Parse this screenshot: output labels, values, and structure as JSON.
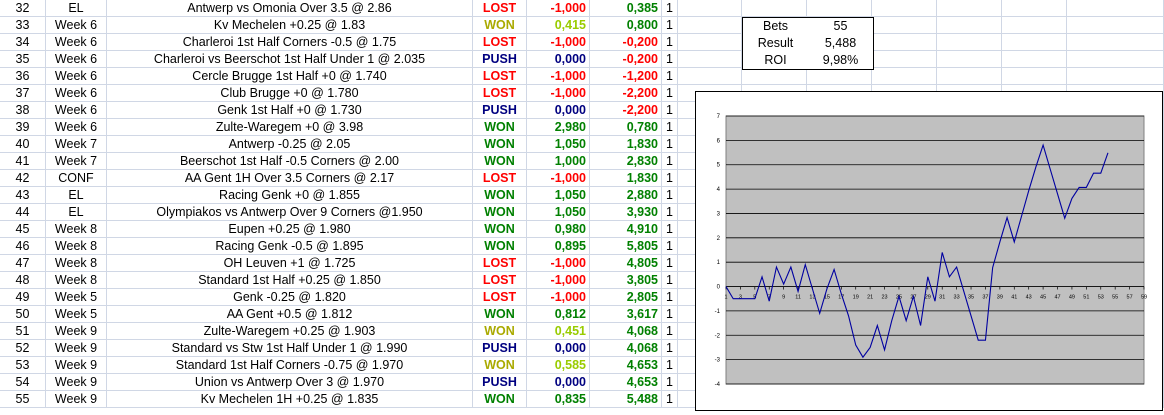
{
  "rows": [
    {
      "n": "32",
      "comp": "EL",
      "bet": "Antwerp vs Omonia Over 3.5 @ 2.86",
      "res": "LOST",
      "profit": "-1,000",
      "total": "0,385",
      "stake": "1"
    },
    {
      "n": "33",
      "comp": "Week 6",
      "bet": "Kv Mechelen +0.25 @ 1.83",
      "res": "WON",
      "profit": "0,415",
      "total": "0,800",
      "stake": "1"
    },
    {
      "n": "34",
      "comp": "Week 6",
      "bet": "Charleroi 1st Half Corners -0.5 @ 1.75",
      "res": "LOST",
      "profit": "-1,000",
      "total": "-0,200",
      "stake": "1"
    },
    {
      "n": "35",
      "comp": "Week 6",
      "bet": "Charleroi vs Beerschot 1st Half Under 1 @ 2.035",
      "res": "PUSH",
      "profit": "0,000",
      "total": "-0,200",
      "stake": "1"
    },
    {
      "n": "36",
      "comp": "Week 6",
      "bet": "Cercle Brugge 1st Half +0 @ 1.740",
      "res": "LOST",
      "profit": "-1,000",
      "total": "-1,200",
      "stake": "1"
    },
    {
      "n": "37",
      "comp": "Week 6",
      "bet": "Club Brugge +0 @ 1.780",
      "res": "LOST",
      "profit": "-1,000",
      "total": "-2,200",
      "stake": "1"
    },
    {
      "n": "38",
      "comp": "Week 6",
      "bet": "Genk 1st Half +0 @ 1.730",
      "res": "PUSH",
      "profit": "0,000",
      "total": "-2,200",
      "stake": "1"
    },
    {
      "n": "39",
      "comp": "Week 6",
      "bet": "Zulte-Waregem +0 @ 3.98",
      "res": "WON",
      "profit": "2,980",
      "total": "0,780",
      "stake": "1"
    },
    {
      "n": "40",
      "comp": "Week 7",
      "bet": "Antwerp -0.25 @ 2.05",
      "res": "WON",
      "profit": "1,050",
      "total": "1,830",
      "stake": "1"
    },
    {
      "n": "41",
      "comp": "Week 7",
      "bet": "Beerschot 1st Half -0.5 Corners @ 2.00",
      "res": "WON",
      "profit": "1,000",
      "total": "2,830",
      "stake": "1"
    },
    {
      "n": "42",
      "comp": "CONF",
      "bet": "AA Gent 1H Over 3.5 Corners @ 2.17",
      "res": "LOST",
      "profit": "-1,000",
      "total": "1,830",
      "stake": "1"
    },
    {
      "n": "43",
      "comp": "EL",
      "bet": "Racing Genk +0 @ 1.855",
      "res": "WON",
      "profit": "1,050",
      "total": "2,880",
      "stake": "1"
    },
    {
      "n": "44",
      "comp": "EL",
      "bet": "Olympiakos vs Antwerp Over 9 Corners @1.950",
      "res": "WON",
      "profit": "1,050",
      "total": "3,930",
      "stake": "1"
    },
    {
      "n": "45",
      "comp": "Week 8",
      "bet": "Eupen +0.25 @ 1.980",
      "res": "WON",
      "profit": "0,980",
      "total": "4,910",
      "stake": "1"
    },
    {
      "n": "46",
      "comp": "Week 8",
      "bet": "Racing Genk -0.5 @ 1.895",
      "res": "WON",
      "profit": "0,895",
      "total": "5,805",
      "stake": "1"
    },
    {
      "n": "47",
      "comp": "Week 8",
      "bet": "OH Leuven +1 @ 1.725",
      "res": "LOST",
      "profit": "-1,000",
      "total": "4,805",
      "stake": "1"
    },
    {
      "n": "48",
      "comp": "Week 8",
      "bet": "Standard 1st Half +0.25 @ 1.850",
      "res": "LOST",
      "profit": "-1,000",
      "total": "3,805",
      "stake": "1"
    },
    {
      "n": "49",
      "comp": "Week 5",
      "bet": "Genk -0.25 @ 1.820",
      "res": "LOST",
      "profit": "-1,000",
      "total": "2,805",
      "stake": "1"
    },
    {
      "n": "50",
      "comp": "Week 5",
      "bet": "AA Gent +0.5 @ 1.812",
      "res": "WON",
      "profit": "0,812",
      "total": "3,617",
      "stake": "1"
    },
    {
      "n": "51",
      "comp": "Week 9",
      "bet": "Zulte-Waregem +0.25 @ 1.903",
      "res": "WON",
      "profit": "0,451",
      "total": "4,068",
      "stake": "1"
    },
    {
      "n": "52",
      "comp": "Week 9",
      "bet": "Standard vs Stw 1st Half Under 1 @ 1.990",
      "res": "PUSH",
      "profit": "0,000",
      "total": "4,068",
      "stake": "1"
    },
    {
      "n": "53",
      "comp": "Week 9",
      "bet": "Standard 1st Half Corners -0.75 @ 1.970",
      "res": "WON",
      "profit": "0,585",
      "total": "4,653",
      "stake": "1"
    },
    {
      "n": "54",
      "comp": "Week 9",
      "bet": "Union vs Antwerp Over 3 @ 1.970",
      "res": "PUSH",
      "profit": "0,000",
      "total": "4,653",
      "stake": "1"
    },
    {
      "n": "55",
      "comp": "Week 9",
      "bet": "Kv Mechelen 1H +0.25 @ 1.835",
      "res": "WON",
      "profit": "0,835",
      "total": "5,488",
      "stake": "1"
    }
  ],
  "row_styles": {
    "33": {
      "res": "wonh",
      "profit": "half"
    },
    "51": {
      "res": "wonh",
      "profit": "half"
    },
    "53": {
      "res": "wonh",
      "profit": "half"
    }
  },
  "stats": {
    "bets_label": "Bets",
    "bets_value": "55",
    "result_label": "Result",
    "result_value": "5,488",
    "roi_label": "ROI",
    "roi_value": "9,98%"
  },
  "colors": {
    "won": "#008000",
    "lost": "#ff0000",
    "push": "#000080",
    "line": "#0000a0",
    "plot_bg": "#c0c0c0"
  },
  "chart_data": {
    "type": "line",
    "x": [
      1,
      2,
      3,
      4,
      5,
      6,
      7,
      8,
      9,
      10,
      11,
      12,
      13,
      14,
      15,
      16,
      17,
      18,
      19,
      20,
      21,
      22,
      23,
      24,
      25,
      26,
      27,
      28,
      29,
      30,
      31,
      32,
      33,
      34,
      35,
      36,
      37,
      38,
      39,
      40,
      41,
      42,
      43,
      44,
      45,
      46,
      47,
      48,
      49,
      50,
      51,
      52,
      53,
      54,
      55
    ],
    "values": [
      0,
      -0.5,
      -0.5,
      -0.5,
      -0.5,
      0.4,
      -0.6,
      0.8,
      0.1,
      0.8,
      -0.2,
      0.9,
      -0.1,
      -1.1,
      -0.1,
      0.7,
      -0.3,
      -1.2,
      -2.4,
      -2.9,
      -2.5,
      -1.6,
      -2.6,
      -1.4,
      -0.4,
      -1.4,
      -0.4,
      -1.6,
      0.4,
      -0.6,
      1.4,
      0.4,
      0.8,
      -0.2,
      -1.2,
      -2.2,
      -2.2,
      0.78,
      1.83,
      2.83,
      1.83,
      2.88,
      3.93,
      4.91,
      5.805,
      4.805,
      3.805,
      2.805,
      3.617,
      4.068,
      4.068,
      4.653,
      4.653,
      5.488
    ],
    "ylim": [
      -4,
      7
    ],
    "xlim": [
      1,
      59
    ],
    "yticks": [
      -4,
      -3,
      -2,
      -1,
      0,
      1,
      2,
      3,
      4,
      5,
      6,
      7
    ],
    "xticks": [
      1,
      3,
      5,
      7,
      9,
      11,
      13,
      15,
      17,
      19,
      21,
      23,
      25,
      27,
      29,
      31,
      33,
      35,
      37,
      39,
      41,
      43,
      45,
      47,
      49,
      51,
      53,
      55,
      57,
      59
    ],
    "grid": true
  }
}
